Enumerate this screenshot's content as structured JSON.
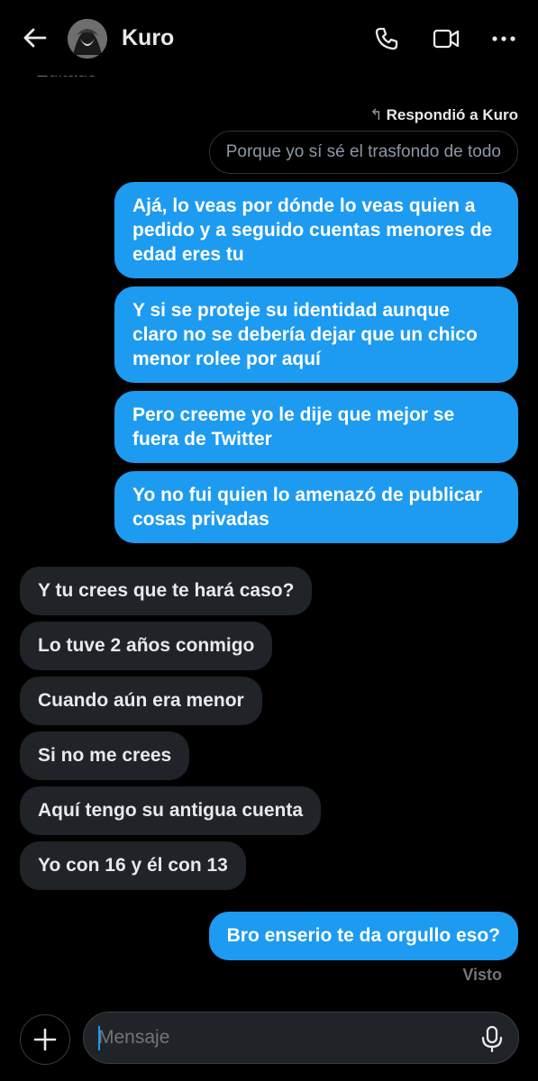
{
  "header": {
    "contact_name": "Kuro",
    "icons": [
      "back-arrow-icon",
      "avatar",
      "phone-icon",
      "video-icon",
      "more-icon"
    ]
  },
  "edited_label": "Editado",
  "reply": {
    "meta": "Respondió a Kuro",
    "quote": "Porque yo sí sé el trasfondo de todo"
  },
  "messages": {
    "outgoing": [
      "Ajá, lo veas por dónde lo veas quien a pedido y a seguido cuentas menores de edad eres tu",
      "Y si se proteje su identidad aunque claro no se debería dejar que un chico menor rolee por aquí",
      "Pero creeme yo le dije que mejor se fuera de Twitter",
      "Yo no fui quien lo amenazó de publicar cosas privadas",
      "Bro enserio te da orgullo eso?"
    ],
    "incoming": [
      "Y tu crees que te hará caso?",
      "Lo tuve 2 años conmigo",
      "Cuando aún era menor",
      "Si no me crees",
      "Aquí tengo su antigua cuenta",
      "Yo con 16 y él con 13"
    ]
  },
  "status": "Visto",
  "composer": {
    "placeholder": "Mensaje",
    "value": ""
  },
  "colors": {
    "background": "#000000",
    "outgoing_bubble": "#1d9bf0",
    "incoming_bubble": "#202327",
    "muted_text": "#71767b"
  }
}
